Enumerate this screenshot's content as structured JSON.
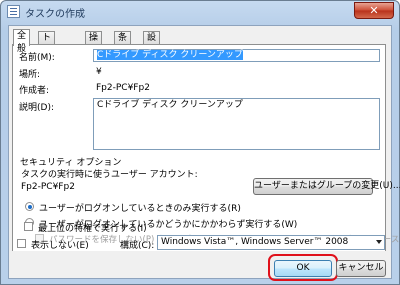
{
  "window": {
    "title": "タスクの作成",
    "close_label": "✕"
  },
  "tabs": [
    {
      "label": "全般",
      "active": true
    },
    {
      "label": "トリガー",
      "active": false
    },
    {
      "label": "操作",
      "active": false
    },
    {
      "label": "条件",
      "active": false
    },
    {
      "label": "設定",
      "active": false
    }
  ],
  "general": {
    "name_label": "名前(M):",
    "name_value": "Cドライブ ディスク クリーンアップ",
    "location_label": "場所:",
    "location_value": "¥",
    "author_label": "作成者:",
    "author_value": "Fp2-PC¥Fp2",
    "description_label": "説明(D):",
    "description_value": "Cドライブ ディスク クリーンアップ"
  },
  "security": {
    "group_title": "セキュリティ オプション",
    "account_prompt": "タスクの実行時に使うユーザー アカウント:",
    "account_value": "Fp2-PC¥Fp2",
    "change_button": "ユーザーまたはグループの変更(U)...",
    "radio_logged_on": "ユーザーがログオンしているときのみ実行する(R)",
    "radio_whether": "ユーザーがログオンしているかどうかにかかわらず実行する(W)",
    "no_store_password": "パスワードを保存しない(P) タスクがアクセスできるのはローカル コンピューター リソースのみ",
    "highest_privileges": "最上位の特権で実行する(I)"
  },
  "footer": {
    "hidden_label": "表示しない(E)",
    "configure_label": "構成(C):",
    "configure_value": "Windows Vista™, Windows Server™ 2008",
    "ok_button": "OK",
    "cancel_button": "キャンセル"
  },
  "colors": {
    "highlight": "#e0101a",
    "selection": "#3399ff"
  }
}
